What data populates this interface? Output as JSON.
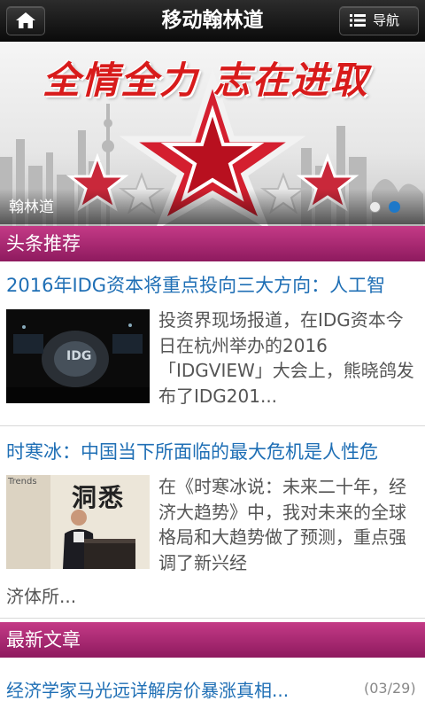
{
  "header": {
    "title": "移动翰林道",
    "nav_label": "导航"
  },
  "banner": {
    "headline": "全情全力 志在进取",
    "caption": "翰林道",
    "slide_count": 2,
    "active_slide": 2
  },
  "sections": {
    "headlines": "头条推荐",
    "latest": "最新文章"
  },
  "articles": [
    {
      "title": "2016年IDG资本将重点投向三大方向：人工智",
      "desc": "投资界现场报道，在IDG资本今日在杭州举办的2016「IDGVIEW」大会上，熊晓鸽发布了IDG201...",
      "desc_continued": "",
      "thumb_text": "IDG"
    },
    {
      "title": "时寒冰：中国当下所面临的最大危机是人性危",
      "desc": "在《时寒冰说：未来二十年，经济大趋势》中，我对未来的全球格局和大趋势做了预测，重点强调了新兴经",
      "desc_continued": "济体所...",
      "thumb_text": "洞悉",
      "thumb_sub": "Trends"
    }
  ],
  "latest": [
    {
      "title": "经济学家马光远详解房价暴涨真相...",
      "date": "(03/29)"
    }
  ],
  "colors": {
    "accent": "#1f6fb5",
    "section": "#a8246f",
    "topbar": "#111111",
    "dot_active": "#1e78c8"
  }
}
